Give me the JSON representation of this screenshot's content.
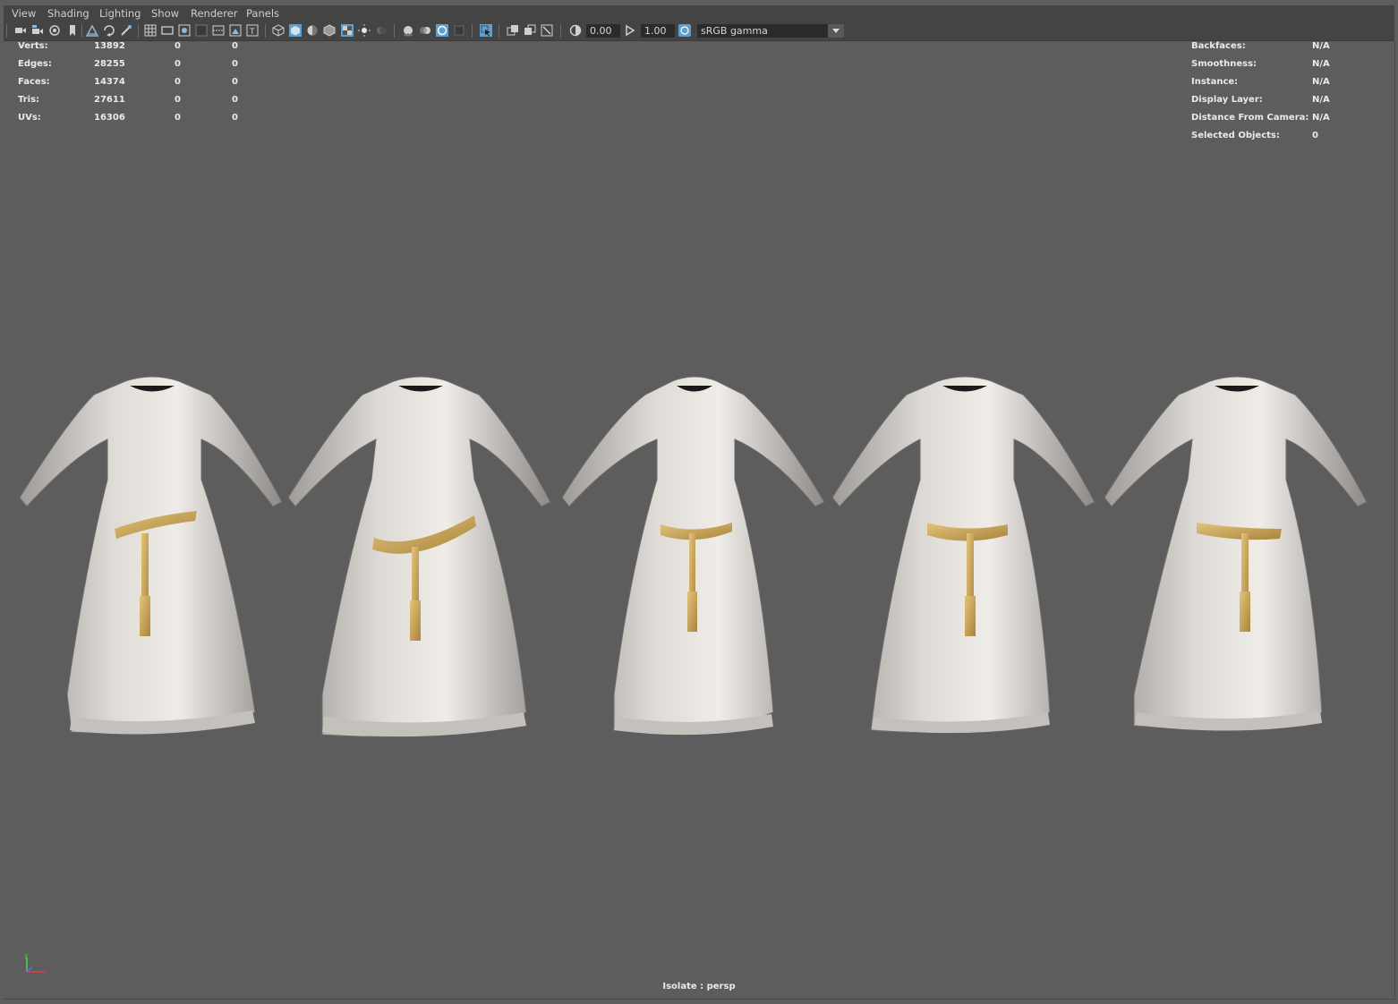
{
  "menu": [
    "View",
    "Shading",
    "Lighting",
    "Show",
    "Renderer",
    "Panels"
  ],
  "toolbar": {
    "exposure_value": "0.00",
    "gamma_value": "1.00",
    "color_space": "sRGB gamma"
  },
  "hud_left": {
    "rows": [
      {
        "label": "Verts:",
        "value": "13892",
        "col2": "0",
        "col3": "0"
      },
      {
        "label": "Edges:",
        "value": "28255",
        "col2": "0",
        "col3": "0"
      },
      {
        "label": "Faces:",
        "value": "14374",
        "col2": "0",
        "col3": "0"
      },
      {
        "label": "Tris:",
        "value": "27611",
        "col2": "0",
        "col3": "0"
      },
      {
        "label": "UVs:",
        "value": "16306",
        "col2": "0",
        "col3": "0"
      }
    ]
  },
  "hud_right": {
    "rows": [
      {
        "label": "Backfaces:",
        "value": "N/A"
      },
      {
        "label": "Smoothness:",
        "value": "N/A"
      },
      {
        "label": "Instance:",
        "value": "N/A"
      },
      {
        "label": "Display Layer:",
        "value": "N/A"
      },
      {
        "label": "Distance From Camera:",
        "value": "N/A"
      },
      {
        "label": "Selected Objects:",
        "value": "0"
      }
    ]
  },
  "isolate_label": "Isolate : persp",
  "axis": {
    "y": "y",
    "x": "x"
  },
  "colors": {
    "viewport_bg": "#5d5d5d",
    "menubar_bg": "#444444",
    "active_icon": "#5f9fd0",
    "dress_fabric": "#d4d0cc",
    "belt_gold": "#c9a552"
  },
  "icons": [
    "camera-icon",
    "camera-attr-icon",
    "bookmark-icon",
    "image-plane-icon",
    "grid-icon",
    "film-gate-icon",
    "resolution-gate-icon",
    "gate-mask-icon",
    "field-chart-icon",
    "safe-action-icon",
    "safe-title-icon",
    "wireframe-icon",
    "smooth-shade-icon",
    "default-material-icon",
    "wireframe-on-shaded-icon",
    "textured-icon",
    "lights-icon",
    "shadows-icon",
    "screen-space-ao-icon",
    "motion-blur-icon",
    "anti-alias-icon",
    "depth-of-field-icon",
    "isolate-select-icon",
    "xray-icon",
    "xray-joints-icon",
    "xray-active-icon",
    "exposure-icon",
    "gamma-icon",
    "color-management-icon"
  ]
}
